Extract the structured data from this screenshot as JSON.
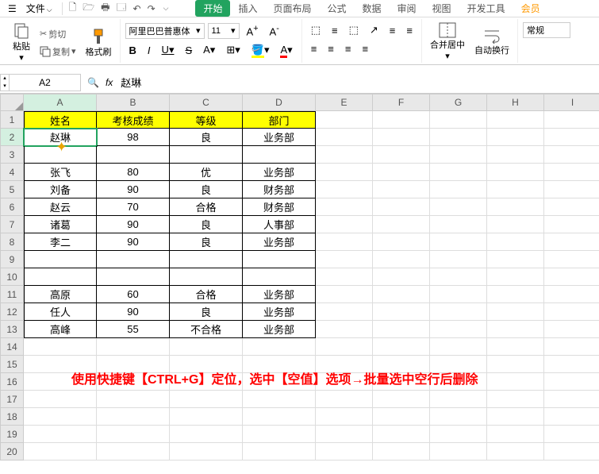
{
  "menubar": {
    "file": "文件",
    "tabs": [
      "开始",
      "插入",
      "页面布局",
      "公式",
      "数据",
      "审阅",
      "视图",
      "开发工具",
      "会员"
    ]
  },
  "ribbon": {
    "paste": "粘贴",
    "cut": "剪切",
    "copy": "复制",
    "format_painter": "格式刷",
    "font_name": "阿里巴巴普惠体",
    "font_size": "11",
    "merge": "合并居中",
    "wrap": "自动换行",
    "style": "常规"
  },
  "formula": {
    "cell_ref": "A2",
    "fx": "fx",
    "value": "赵琳"
  },
  "columns": [
    "A",
    "B",
    "C",
    "D",
    "E",
    "F",
    "G",
    "H",
    "I"
  ],
  "row_count": 20,
  "table": {
    "headers": [
      "姓名",
      "考核成绩",
      "等级",
      "部门"
    ],
    "rows": [
      [
        "赵琳",
        "98",
        "良",
        "业务部"
      ],
      [
        "",
        "",
        "",
        ""
      ],
      [
        "张飞",
        "80",
        "优",
        "业务部"
      ],
      [
        "刘备",
        "90",
        "良",
        "财务部"
      ],
      [
        "赵云",
        "70",
        "合格",
        "财务部"
      ],
      [
        "诸葛",
        "90",
        "良",
        "人事部"
      ],
      [
        "李二",
        "90",
        "良",
        "业务部"
      ],
      [
        "",
        "",
        "",
        ""
      ],
      [
        "",
        "",
        "",
        ""
      ],
      [
        "高原",
        "60",
        "合格",
        "业务部"
      ],
      [
        "任人",
        "90",
        "良",
        "业务部"
      ],
      [
        "高峰",
        "55",
        "不合格",
        "业务部"
      ]
    ]
  },
  "instruction": "使用快捷键【CTRL+G】定位，选中【空值】选项→批量选中空行后删除",
  "icons": {
    "scissors": "✂",
    "search": "🔍"
  }
}
